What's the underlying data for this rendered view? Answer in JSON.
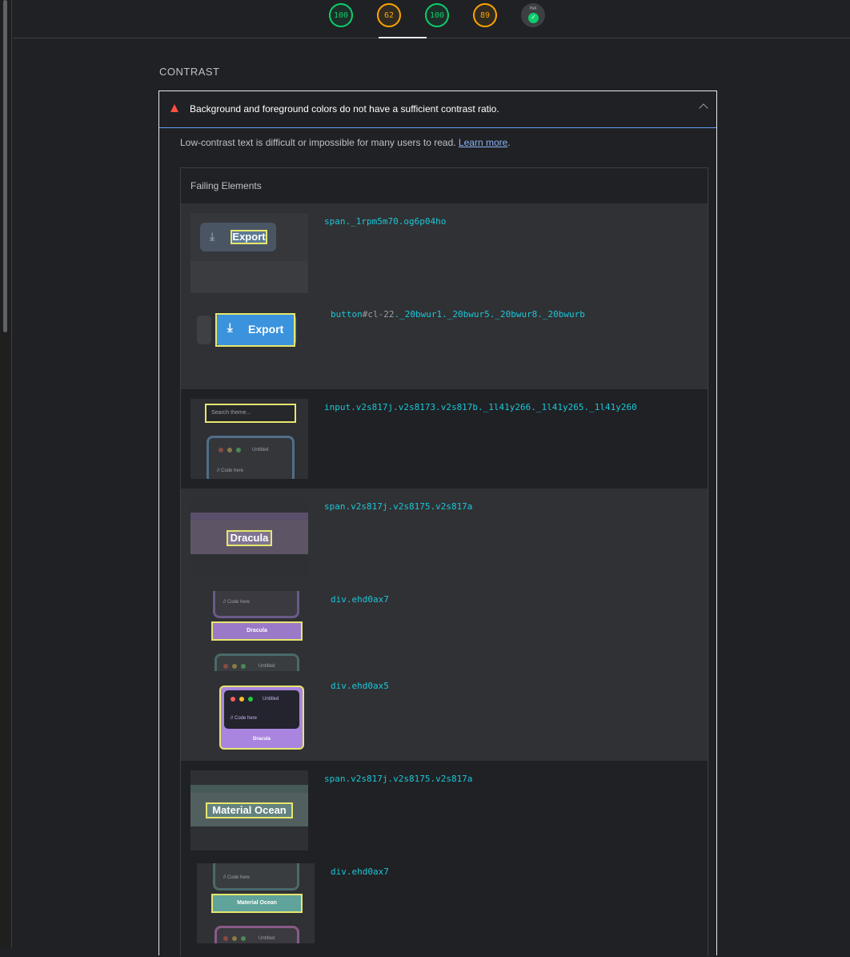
{
  "scores": [
    {
      "label": "100",
      "kind": "pass"
    },
    {
      "label": "62",
      "kind": "avg"
    },
    {
      "label": "100",
      "kind": "pass"
    },
    {
      "label": "89",
      "kind": "avg"
    },
    {
      "label": "PWA",
      "kind": "pwa"
    }
  ],
  "section": {
    "title": "CONTRAST"
  },
  "audit": {
    "title": "Background and foreground colors do not have a sufficient contrast ratio.",
    "description": "Low-contrast text is difficult or impossible for many users to read. ",
    "learn_more": "Learn more",
    "period": ".",
    "table_header": "Failing Elements"
  },
  "rows": [
    {
      "selector": "span._1rpm5m70.og6p04ho",
      "thumb_text": "Export"
    },
    {
      "selector_main": "button",
      "selector_grey": "#cl-22",
      "selector_rest": "._20bwur1._20bwur5._20bwur8._20bwurb",
      "thumb_text": "Export"
    },
    {
      "selector": "input.v2s817j.v2s8173.v2s817b._1l41y266._1l41y265._1l41y260",
      "thumb_placeholder": "Search theme...",
      "thumb_tab": "Untitled",
      "thumb_code": "// Code here"
    },
    {
      "selector": "span.v2s817j.v2s8175.v2s817a",
      "thumb_text": "Dracula"
    },
    {
      "selector": "div.ehd0ax7",
      "thumb_code": "// Code here",
      "thumb_text": "Dracula",
      "thumb_tab": "Untitled"
    },
    {
      "selector": "div.ehd0ax5",
      "thumb_tab": "Untitled",
      "thumb_code": "// Code here",
      "thumb_text": "Dracula"
    },
    {
      "selector": "span.v2s817j.v2s8175.v2s817a",
      "thumb_text": "Material Ocean"
    },
    {
      "selector": "div.ehd0ax7",
      "thumb_code": "// Code here",
      "thumb_text": "Material Ocean",
      "thumb_tab": "Untitled"
    }
  ],
  "colors": {
    "pass": "#0cce6b",
    "average": "#ffa400",
    "fail": "#ff4e42",
    "selector": "#1ac6d8",
    "highlight": "#e6e66e"
  }
}
